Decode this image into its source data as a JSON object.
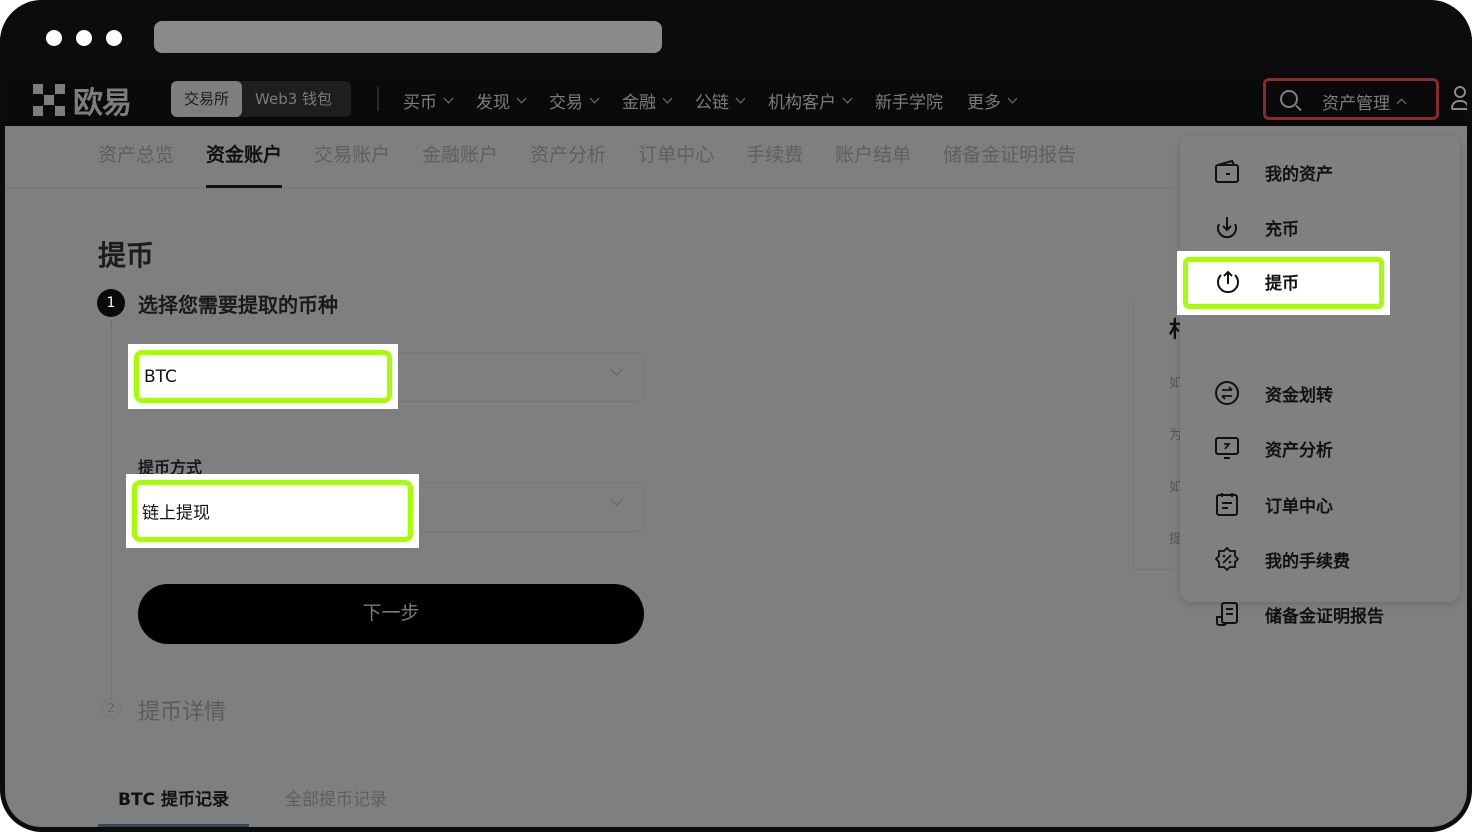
{
  "browser": {
    "url": ""
  },
  "topnav": {
    "logo_text": "欧易",
    "segment": [
      {
        "label": "交易所",
        "active": true
      },
      {
        "label": "Web3 钱包",
        "active": false
      }
    ],
    "links": [
      {
        "label": "买币",
        "has_dropdown": true
      },
      {
        "label": "发现",
        "has_dropdown": true
      },
      {
        "label": "交易",
        "has_dropdown": true
      },
      {
        "label": "金融",
        "has_dropdown": true
      },
      {
        "label": "公链",
        "has_dropdown": true
      },
      {
        "label": "机构客户",
        "has_dropdown": true
      },
      {
        "label": "新手学院",
        "has_dropdown": false
      },
      {
        "label": "更多",
        "has_dropdown": true
      }
    ],
    "asset_management_label": "资产管理",
    "highlight_color": "#8a2a2a"
  },
  "subtabs": [
    {
      "label": "资产总览",
      "active": false
    },
    {
      "label": "资金账户",
      "active": true
    },
    {
      "label": "交易账户",
      "active": false
    },
    {
      "label": "金融账户",
      "active": false
    },
    {
      "label": "资产分析",
      "active": false
    },
    {
      "label": "订单中心",
      "active": false
    },
    {
      "label": "手续费",
      "active": false
    },
    {
      "label": "账户结单",
      "active": false
    },
    {
      "label": "储备金证明报告",
      "active": false
    }
  ],
  "main": {
    "page_title": "提币",
    "step1": {
      "number": "1",
      "title": "选择您需要提取的币种",
      "coin_value": "BTC",
      "method_label": "提币方式",
      "method_value": "链上提现",
      "next_button": "下一步"
    },
    "step2": {
      "number": "2",
      "title": "提币详情"
    },
    "record_tabs": [
      {
        "label": "BTC 提币记录",
        "active": true
      },
      {
        "label": "全部提币记录",
        "active": false
      }
    ],
    "side_panel": {
      "title_fragment": "村",
      "line_fragments": [
        "如",
        "为",
        "如",
        "提"
      ]
    }
  },
  "dropdown": {
    "items": [
      {
        "label": "我的资产",
        "icon": "wallet-icon"
      },
      {
        "label": "充币",
        "icon": "deposit-icon"
      },
      {
        "label": "提币",
        "icon": "withdraw-icon",
        "highlighted": true
      },
      {
        "label": "资金划转",
        "icon": "transfer-icon"
      },
      {
        "label": "资产分析",
        "icon": "analysis-icon"
      },
      {
        "label": "订单中心",
        "icon": "order-icon"
      },
      {
        "label": "我的手续费",
        "icon": "fee-icon"
      },
      {
        "label": "储备金证明报告",
        "icon": "report-icon"
      }
    ]
  },
  "highlight": {
    "color": "#a6ff00"
  }
}
